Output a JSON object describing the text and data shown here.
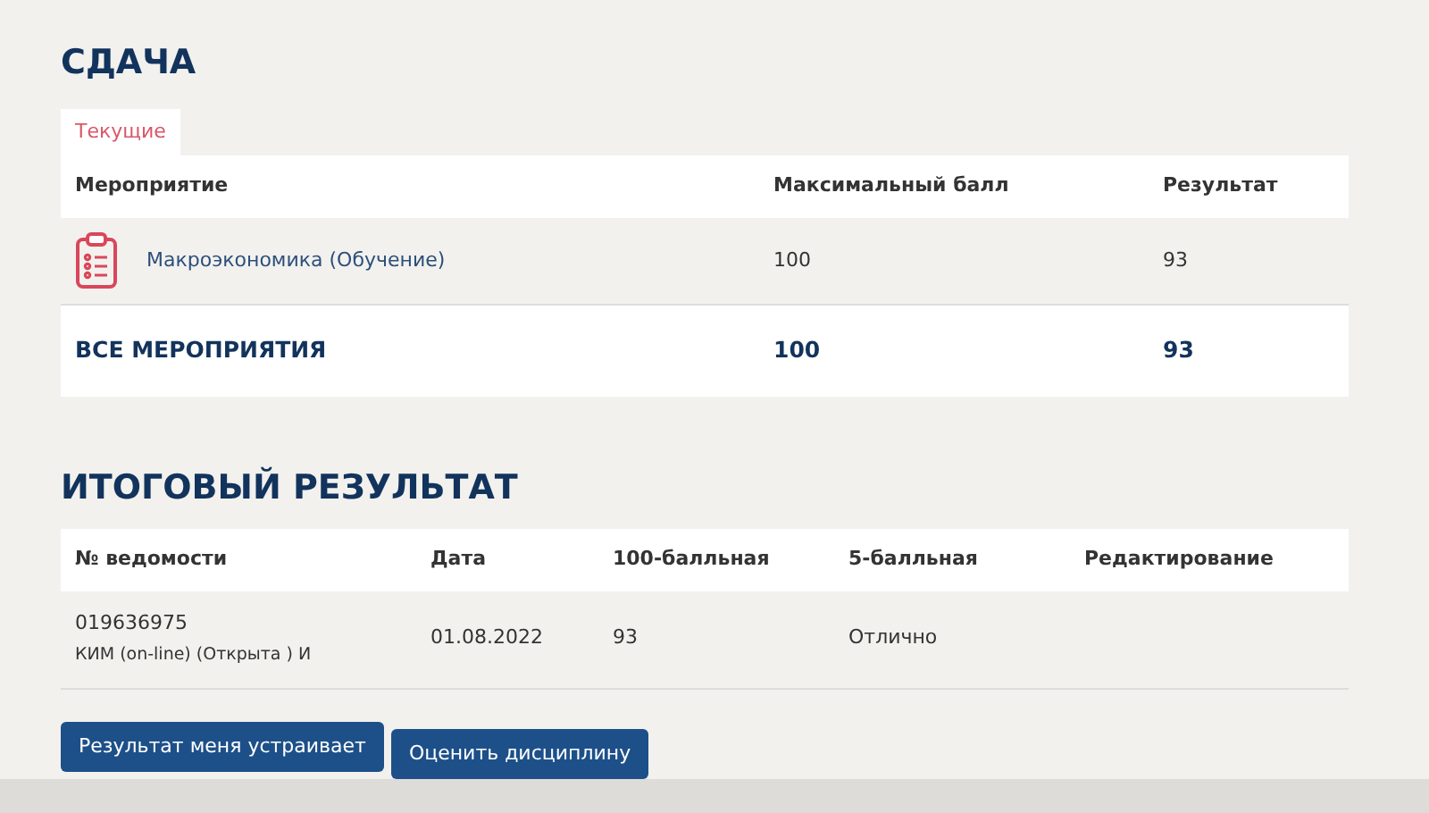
{
  "submission": {
    "title": "СДАЧА",
    "tabs": [
      {
        "label": "Текущие",
        "selected": true
      }
    ],
    "columns": [
      "Мероприятие",
      "Максимальный балл",
      "Результат"
    ],
    "rows": [
      {
        "name": "Макроэкономика (Обучение)",
        "max": "100",
        "result": "93"
      }
    ],
    "total": {
      "label": "ВСЕ МЕРОПРИЯТИЯ",
      "max": "100",
      "result": "93"
    }
  },
  "final": {
    "title": "ИТОГОВЫЙ РЕЗУЛЬТАТ",
    "columns": [
      "№ ведомости",
      "Дата",
      "100-балльная",
      "5-балльная",
      "Редактирование"
    ],
    "rows": [
      {
        "number": "019636975",
        "note": "КИМ (on-line) (Открыта ) И",
        "date": "01.08.2022",
        "score100": "93",
        "score5": "Отлично"
      }
    ]
  },
  "buttons": [
    "Результат меня устраивает",
    "Оценить дисциплину"
  ]
}
